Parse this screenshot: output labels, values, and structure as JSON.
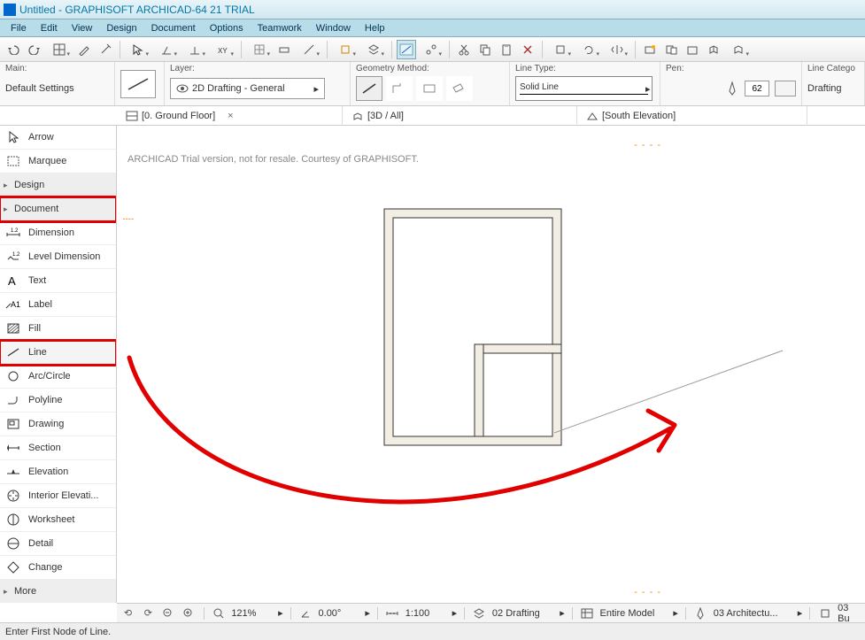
{
  "title": "Untitled - GRAPHISOFT ARCHICAD-64 21 TRIAL",
  "menu": [
    "File",
    "Edit",
    "View",
    "Design",
    "Document",
    "Options",
    "Teamwork",
    "Window",
    "Help"
  ],
  "infobar": {
    "main_label": "Main:",
    "default_settings": "Default Settings",
    "layer_label": "Layer:",
    "layer_value": "2D Drafting - General",
    "geom_label": "Geometry Method:",
    "linetype_label": "Line Type:",
    "linetype_value": "Solid Line",
    "pen_label": "Pen:",
    "pen_value": "62",
    "linecat_label": "Line Catego",
    "linecat_value": "Drafting"
  },
  "tabs": [
    {
      "label": "[0. Ground Floor]",
      "closable": true
    },
    {
      "label": "[3D / All]",
      "closable": false
    },
    {
      "label": "[South Elevation]",
      "closable": false
    }
  ],
  "toolbox": {
    "arrow": "Arrow",
    "marquee": "Marquee",
    "design_hdr": "Design",
    "document_hdr": "Document",
    "dimension": "Dimension",
    "level_dimension": "Level Dimension",
    "text": "Text",
    "label": "Label",
    "fill": "Fill",
    "line": "Line",
    "arc": "Arc/Circle",
    "polyline": "Polyline",
    "drawing": "Drawing",
    "section": "Section",
    "elevation": "Elevation",
    "interior_elev": "Interior Elevati...",
    "worksheet": "Worksheet",
    "detail": "Detail",
    "change": "Change",
    "more_hdr": "More"
  },
  "trial_text": "ARCHICAD Trial version, not for resale. Courtesy of GRAPHISOFT.",
  "navbar": {
    "zoom": "121%",
    "angle": "0.00°",
    "scale": "1:100",
    "layer_combo": "02 Drafting",
    "model": "Entire Model",
    "arch": "03 Architectu...",
    "bu": "03 Bu"
  },
  "status": "Enter First Node of Line."
}
